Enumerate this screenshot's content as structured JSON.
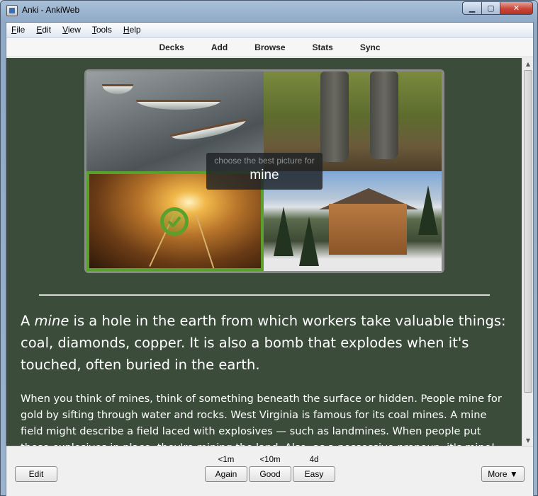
{
  "window": {
    "title": "Anki - AnkiWeb",
    "controls": {
      "minimize": "▁",
      "maximize": "▢",
      "close": "✕"
    }
  },
  "menubar": {
    "items": [
      {
        "label_ul": "F",
        "label_rest": "ile"
      },
      {
        "label_ul": "E",
        "label_rest": "dit"
      },
      {
        "label_ul": "V",
        "label_rest": "iew"
      },
      {
        "label_ul": "T",
        "label_rest": "ools"
      },
      {
        "label_ul": "H",
        "label_rest": "elp"
      }
    ]
  },
  "toolbar": {
    "decks": "Decks",
    "add": "Add",
    "browse": "Browse",
    "stats": "Stats",
    "sync": "Sync"
  },
  "card": {
    "prompt_hint": "choose the best picture for",
    "prompt_word": "mine",
    "definition_pre": "A ",
    "definition_word": "mine",
    "definition_post": " is a hole in the earth from which workers take valuable things: coal, diamonds, copper. It is also a bomb that explodes when it's touched, often buried in the earth.",
    "explanation": "When you think of mines, think of something beneath the surface or hidden. People mine for gold by sifting through water and rocks. West Virginia is famous for its coal mines. A mine field might describe a field laced with explosives — such as landmines. When people put these explosives in place, they're mining the land. Also, as a possessive pronoun, it's mine!",
    "colors": {
      "background": "#3b4d3a",
      "selected_border": "#5aa02c"
    }
  },
  "bottombar": {
    "edit": "Edit",
    "more": "More ▼",
    "answers": [
      {
        "interval": "<1m",
        "label": "Again"
      },
      {
        "interval": "<10m",
        "label": "Good"
      },
      {
        "interval": "4d",
        "label": "Easy"
      }
    ]
  },
  "scrollbar": {
    "up": "▲",
    "down": "▼"
  }
}
